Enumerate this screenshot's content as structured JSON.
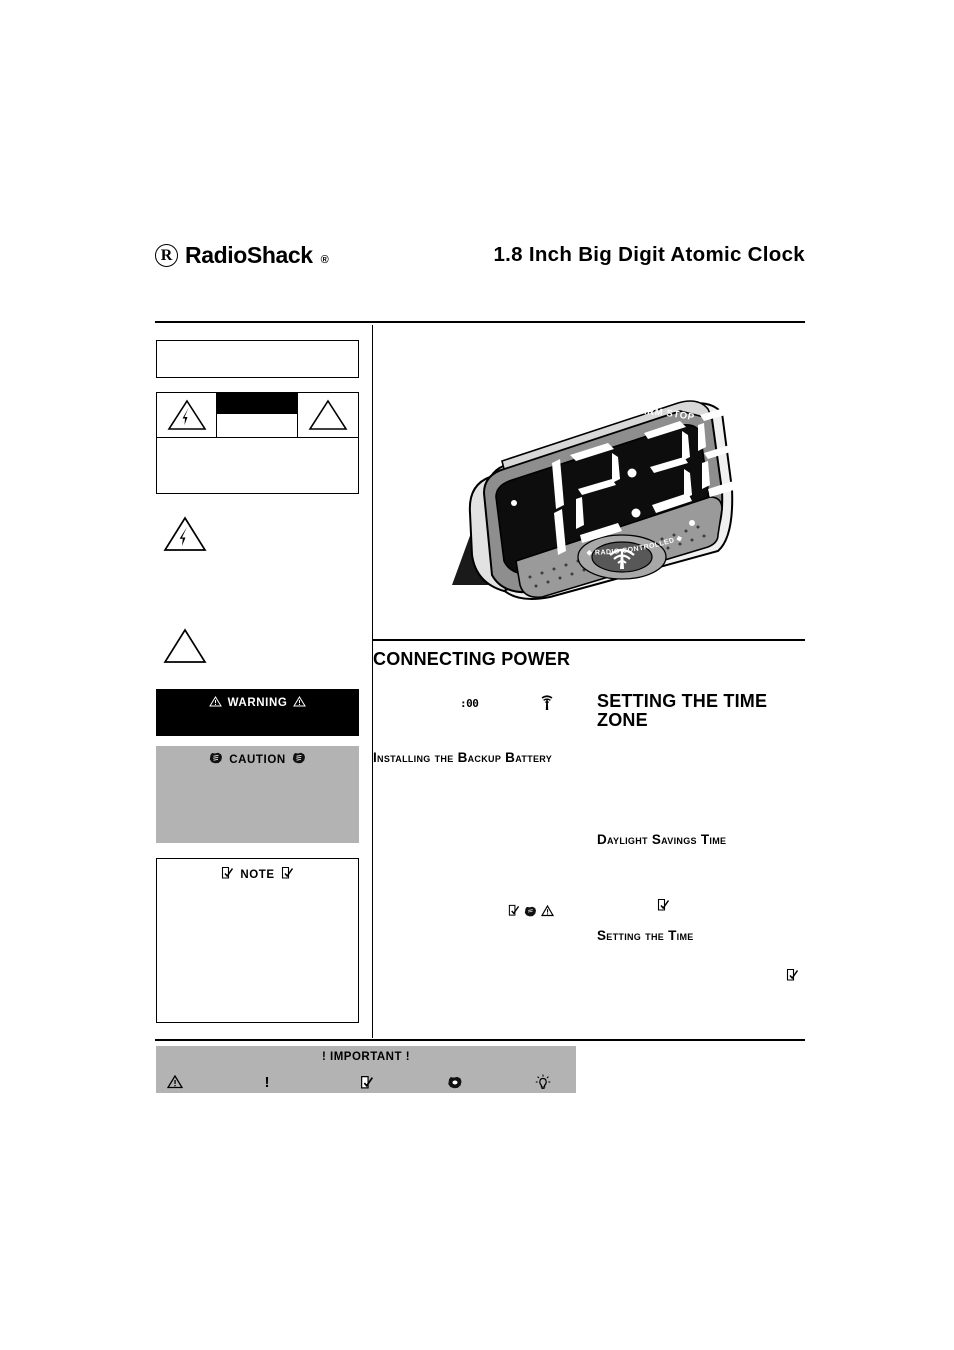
{
  "document": {
    "brand": {
      "mark_letter": "R",
      "name": "RadioShack",
      "registered_mark": "®",
      "mark_icon": "registered-r-icon"
    },
    "title": "1.8 Inch Big Digit Atomic Clock"
  },
  "sidebar": {
    "blank_box_label": "",
    "symbol_key": {
      "shock_icon": "lightning-bolt-triangle-icon",
      "redacted_bar_label": "",
      "alert_icon": "alert-triangle-icon"
    },
    "standalone_icons": [
      {
        "name": "lightning-bolt-triangle-icon",
        "label": ""
      },
      {
        "name": "alert-triangle-icon",
        "label": ""
      }
    ],
    "warning": {
      "label": "WARNING",
      "left_icon": "alert-triangle-icon",
      "right_icon": "alert-triangle-icon",
      "background": "#000000",
      "text_color": "#ffffff"
    },
    "caution": {
      "label": "CAUTION",
      "left_icon": "blot-icon",
      "right_icon": "blot-icon",
      "background": "#b3b3b3",
      "text_color": "#000000"
    },
    "note": {
      "label": "NOTE",
      "left_icon": "note-page-icon",
      "right_icon": "note-page-icon",
      "background": "#ffffff",
      "text_color": "#000000"
    }
  },
  "illustration": {
    "name": "atomic-clock-product-illustration",
    "top_button_label": "SNOOZE/ALARM STOP",
    "display_time": "12:38",
    "display_caption": "RADIO CONTROLLED",
    "caption_diamond": "◆",
    "signal_button_icon": "radio-signal-antenna-icon"
  },
  "main": {
    "section_heading": "CONNECTING POWER",
    "lcd_fragment": ":00",
    "antenna_icon": "antenna-signal-icon",
    "time_zone_heading": "SETTING THE TIME ZONE",
    "subheadings": {
      "installing_battery": "Installing the Backup Battery",
      "daylight_savings": "Daylight Savings Time",
      "setting_the_time": "Setting the Time"
    },
    "inline_icons": [
      "note-page-icon",
      "blot-icon",
      "alert-triangle-icon",
      "note-page-icon",
      "note-page-icon"
    ]
  },
  "legend": {
    "title": "! IMPORTANT !",
    "background": "#b3b3b3",
    "items": [
      {
        "icon": "alert-triangle-icon",
        "glyph": ""
      },
      {
        "icon": "exclamation-icon",
        "glyph": "!"
      },
      {
        "icon": "note-page-icon",
        "glyph": ""
      },
      {
        "icon": "blot-icon",
        "glyph": ""
      },
      {
        "icon": "lightbulb-icon",
        "glyph": ""
      }
    ]
  }
}
